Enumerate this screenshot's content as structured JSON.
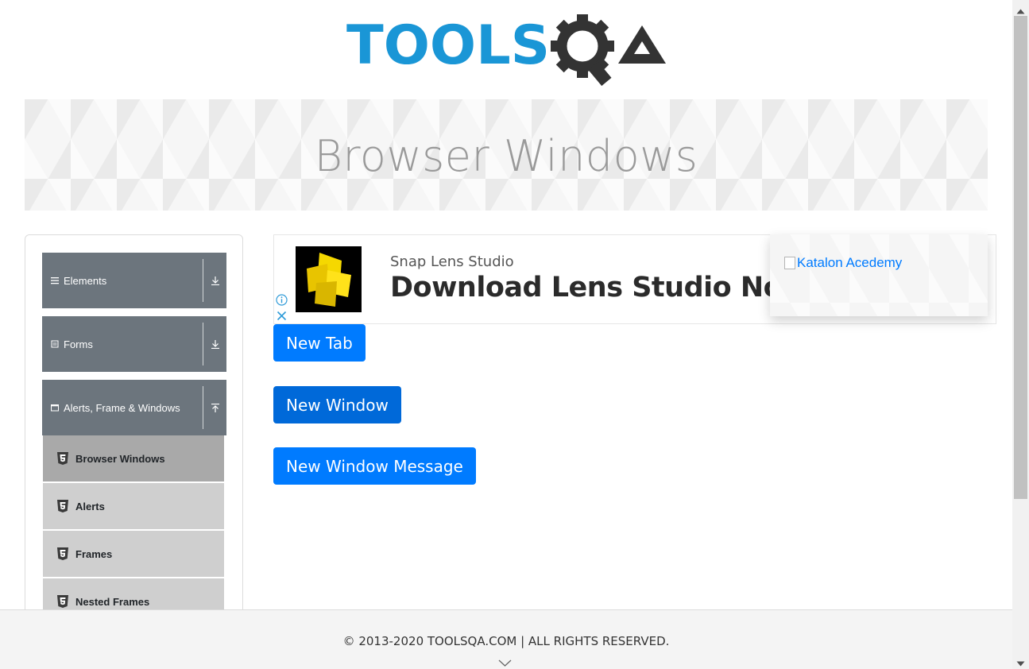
{
  "header": {
    "logo_text": "TOOLSQA",
    "logo_colors": {
      "tools": "#1a96d6",
      "qa": "#333333"
    }
  },
  "banner": {
    "title": "Browser Windows"
  },
  "sidebar": {
    "groups": [
      {
        "label": "Elements",
        "icon": "hamburger-icon",
        "expanded": false
      },
      {
        "label": "Forms",
        "icon": "form-icon",
        "expanded": false
      },
      {
        "label": "Alerts, Frame & Windows",
        "icon": "window-icon",
        "expanded": true
      }
    ],
    "items": [
      {
        "label": "Browser Windows",
        "active": true
      },
      {
        "label": "Alerts",
        "active": false
      },
      {
        "label": "Frames",
        "active": false
      },
      {
        "label": "Nested Frames",
        "active": false
      }
    ]
  },
  "ad": {
    "sponsor": "Snap Lens Studio",
    "headline": "Download Lens Studio Now"
  },
  "promo": {
    "alt_text": "Katalon Acedemy"
  },
  "buttons": {
    "new_tab": "New Tab",
    "new_window": "New Window",
    "new_window_message": "New Window Message"
  },
  "footer": {
    "copyright": "© 2013-2020 TOOLSQA.COM | ALL RIGHTS RESERVED."
  },
  "colors": {
    "primary": "#007bff",
    "primary_focused": "#0069d9",
    "sidebar_group": "#6c757d",
    "sidebar_item": "#cfcfcf",
    "sidebar_item_active": "#a9a9a9"
  }
}
